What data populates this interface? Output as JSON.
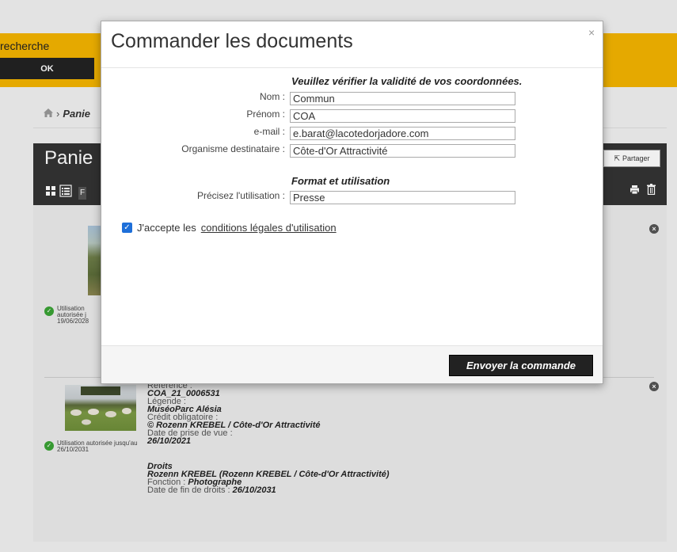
{
  "background": {
    "search_label": "recherche",
    "ok_label": "OK",
    "breadcrumb_label": "Panie",
    "cart_title": "Panie",
    "share_label": "Partager",
    "view_filter_label": "F",
    "items": [
      {
        "usage": "Utilisation autorisée j 19/06/2028"
      },
      {
        "usage": "Utilisation autorisée jusqu'au 26/10/2031",
        "reference_label": "Référence :",
        "reference": "COA_21_0006531",
        "legend_label": "Légende :",
        "legend": "MuséoParc Alésia",
        "credit_label": "Crédit obligatoire :",
        "credit": "© Rozenn KREBEL / Côte-d'Or Attractivité",
        "date_label": "Date de prise de vue :",
        "date": "26/10/2021",
        "rights_title": "Droits",
        "rights_holder": "Rozenn KREBEL (Rozenn KREBEL / Côte-d'Or Attractivité)",
        "function_label": "Fonction :",
        "function": "Photographe",
        "end_date_label": "Date de fin de droits :",
        "end_date": "26/10/2031"
      }
    ]
  },
  "modal": {
    "title": "Commander les documents",
    "close": "×",
    "verify_title": "Veuillez vérifier la validité de vos coordonnées.",
    "fields": [
      {
        "label": "Nom :",
        "value": "Commun"
      },
      {
        "label": "Prénom :",
        "value": "COA"
      },
      {
        "label": "e-mail :",
        "value": "e.barat@lacotedorjadore.com"
      },
      {
        "label": "Organisme destinataire :",
        "value": "Côte-d'Or Attractivité"
      }
    ],
    "format_title": "Format et utilisation",
    "usage_field": {
      "label": "Précisez l'utilisation :",
      "value": "Presse"
    },
    "accept_prefix": "J'accepte les",
    "accept_link": "conditions légales d'utilisation",
    "submit_label": "Envoyer la commande"
  },
  "colors": {
    "accent_yellow": "#f4b400",
    "dark": "#222222",
    "checkbox_blue": "#1e6fd9",
    "success_green": "#3aa335"
  }
}
